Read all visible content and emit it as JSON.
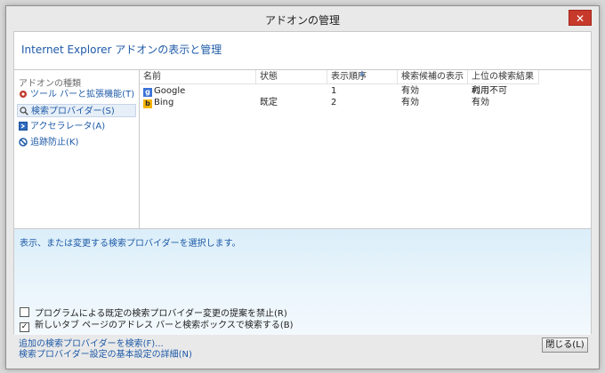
{
  "window": {
    "title": "アドオンの管理",
    "close_glyph": "✕",
    "header_title": "Internet Explorer アドオンの表示と管理"
  },
  "sidebar": {
    "heading": "アドオンの種類",
    "items": [
      {
        "label": "ツール バーと拡張機能(T)",
        "icon": "gear-icon"
      },
      {
        "label": "検索プロバイダー(S)",
        "icon": "search-icon",
        "selected": true
      },
      {
        "label": "アクセラレータ(A)",
        "icon": "accelerator-icon"
      },
      {
        "label": "追跡防止(K)",
        "icon": "block-icon"
      }
    ]
  },
  "table": {
    "columns": [
      "名前",
      "状態",
      "表示順序",
      "検索候補の表示",
      "上位の検索結果の..."
    ],
    "sorted_column_index": 2,
    "rows": [
      {
        "name": "Google",
        "icon": "google-icon",
        "status": "",
        "order": "1",
        "suggestions": "有効",
        "top_result": "利用不可"
      },
      {
        "name": "Bing",
        "icon": "bing-icon",
        "status": "既定",
        "order": "2",
        "suggestions": "有効",
        "top_result": "有効"
      }
    ]
  },
  "details": {
    "description": "表示、または変更する検索プロバイダーを選択します。",
    "checkboxes": [
      {
        "label": "プログラムによる既定の検索プロバイダー変更の提案を禁止(R)",
        "checked": false
      },
      {
        "label": "新しいタブ ページのアドレス バーと検索ボックスで検索する(B)",
        "checked": true
      }
    ]
  },
  "footer": {
    "links": [
      "追加の検索プロバイダーを検索(F)...",
      "検索プロバイダー設定の基本設定の詳細(N)"
    ],
    "close_button": "閉じる(L)"
  },
  "colors": {
    "link_blue": "#1e5aa8",
    "close_red": "#c7392b",
    "panel_blue": "#dbeef9"
  }
}
